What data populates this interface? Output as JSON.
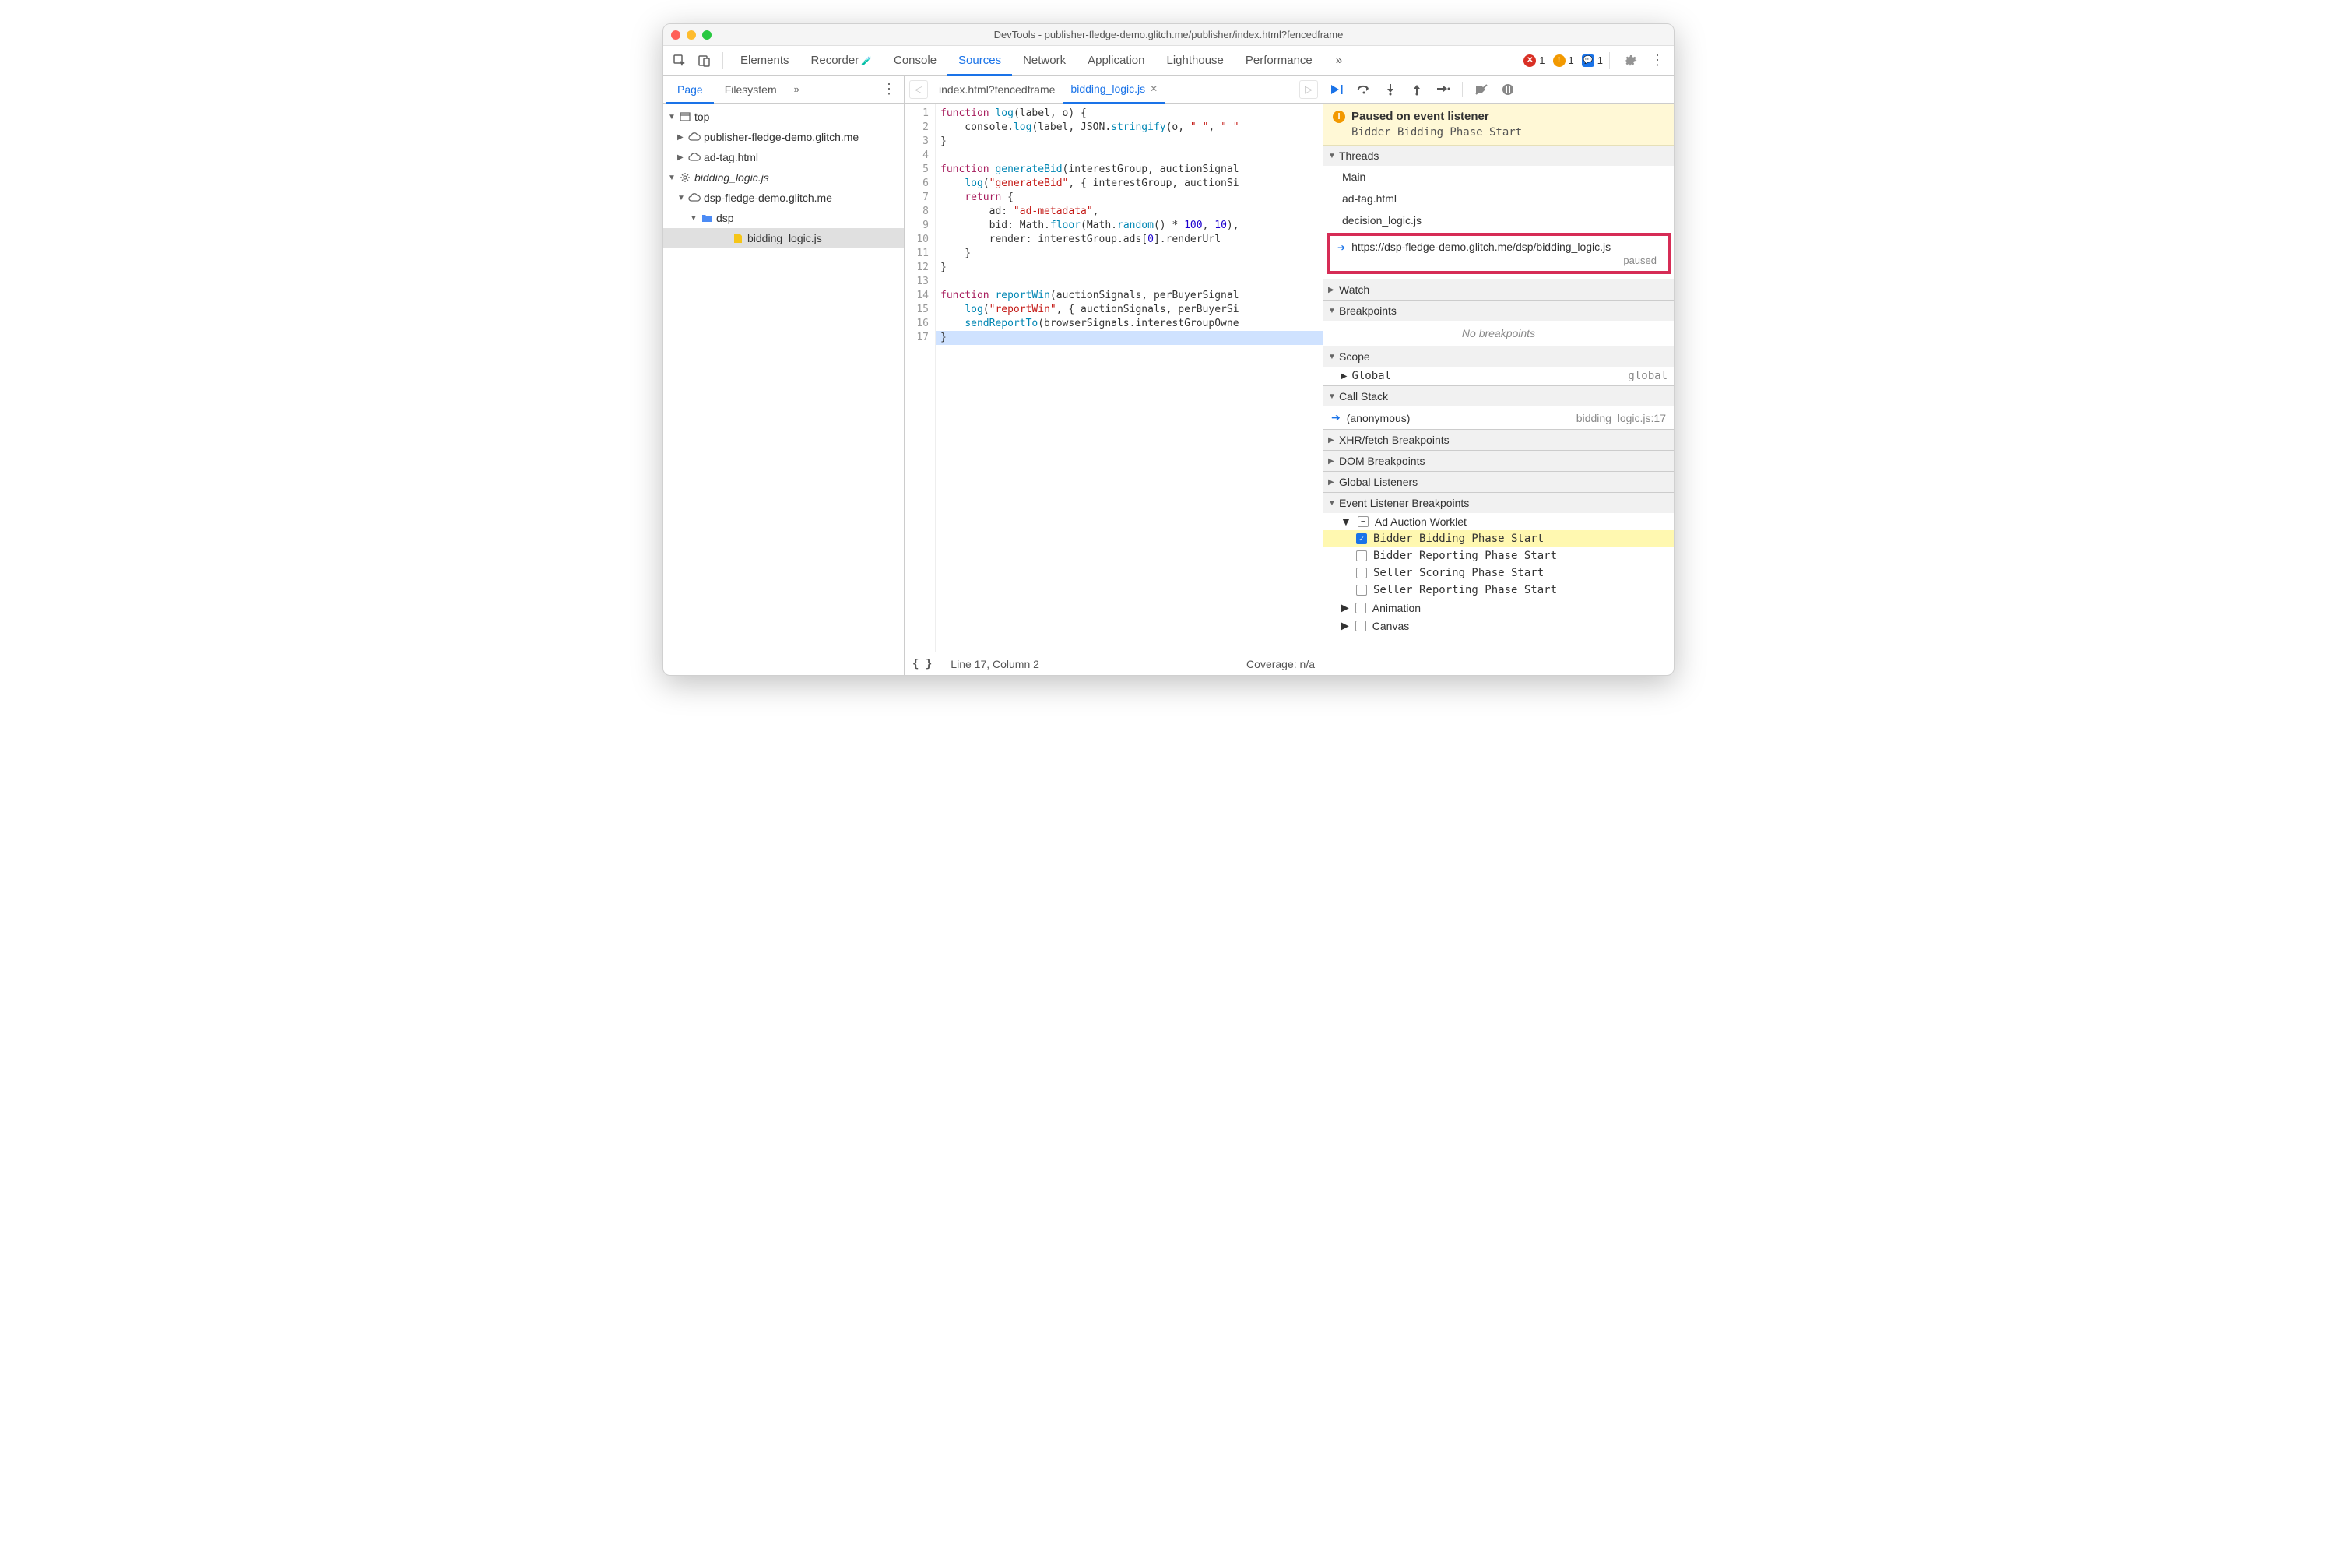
{
  "window": {
    "title": "DevTools - publisher-fledge-demo.glitch.me/publisher/index.html?fencedframe"
  },
  "main_tabs": [
    "Elements",
    "Recorder",
    "Console",
    "Sources",
    "Network",
    "Application",
    "Lighthouse",
    "Performance"
  ],
  "main_active": "Sources",
  "counters": {
    "errors": "1",
    "warnings": "1",
    "messages": "1"
  },
  "nav": {
    "tabs": [
      "Page",
      "Filesystem"
    ],
    "active": "Page"
  },
  "tree": [
    {
      "depth": 0,
      "caret": "▼",
      "icon": "window",
      "label": "top"
    },
    {
      "depth": 1,
      "caret": "▶",
      "icon": "cloud",
      "label": "publisher-fledge-demo.glitch.me"
    },
    {
      "depth": 1,
      "caret": "▶",
      "icon": "cloud",
      "label": "ad-tag.html"
    },
    {
      "depth": 0,
      "caret": "▼",
      "icon": "gear",
      "label": "bidding_logic.js",
      "italic": true
    },
    {
      "depth": 1,
      "caret": "▼",
      "icon": "cloud",
      "label": "dsp-fledge-demo.glitch.me"
    },
    {
      "depth": 2,
      "caret": "▼",
      "icon": "folder",
      "label": "dsp"
    },
    {
      "depth": 4,
      "caret": "",
      "icon": "jsfile",
      "label": "bidding_logic.js",
      "selected": true
    }
  ],
  "file_tabs": [
    {
      "label": "index.html?fencedframe",
      "active": false,
      "close": false
    },
    {
      "label": "bidding_logic.js",
      "active": true,
      "close": true
    }
  ],
  "code_lines": 17,
  "status": {
    "format_icon": "{ }",
    "pos": "Line 17, Column 2",
    "coverage": "Coverage: n/a"
  },
  "pause": {
    "title": "Paused on event listener",
    "detail": "Bidder Bidding Phase Start"
  },
  "threads": {
    "title": "Threads",
    "items": [
      "Main",
      "ad-tag.html",
      "decision_logic.js"
    ],
    "active": {
      "url": "https://dsp-fledge-demo.glitch.me/dsp/bidding_logic.js",
      "state": "paused"
    }
  },
  "sections": {
    "watch": "Watch",
    "breakpoints": "Breakpoints",
    "scope": "Scope",
    "callstack": "Call Stack",
    "xhr": "XHR/fetch Breakpoints",
    "dom": "DOM Breakpoints",
    "global": "Global Listeners",
    "evt": "Event Listener Breakpoints"
  },
  "breakpoints_empty": "No breakpoints",
  "scope": {
    "label": "Global",
    "value": "global"
  },
  "call_stack": {
    "name": "(anonymous)",
    "loc": "bidding_logic.js:17"
  },
  "evt_tree": {
    "group": "Ad Auction Worklet",
    "items": [
      {
        "label": "Bidder Bidding Phase Start",
        "checked": true,
        "hl": true
      },
      {
        "label": "Bidder Reporting Phase Start",
        "checked": false
      },
      {
        "label": "Seller Scoring Phase Start",
        "checked": false
      },
      {
        "label": "Seller Reporting Phase Start",
        "checked": false
      }
    ],
    "tail": [
      "Animation",
      "Canvas"
    ]
  }
}
